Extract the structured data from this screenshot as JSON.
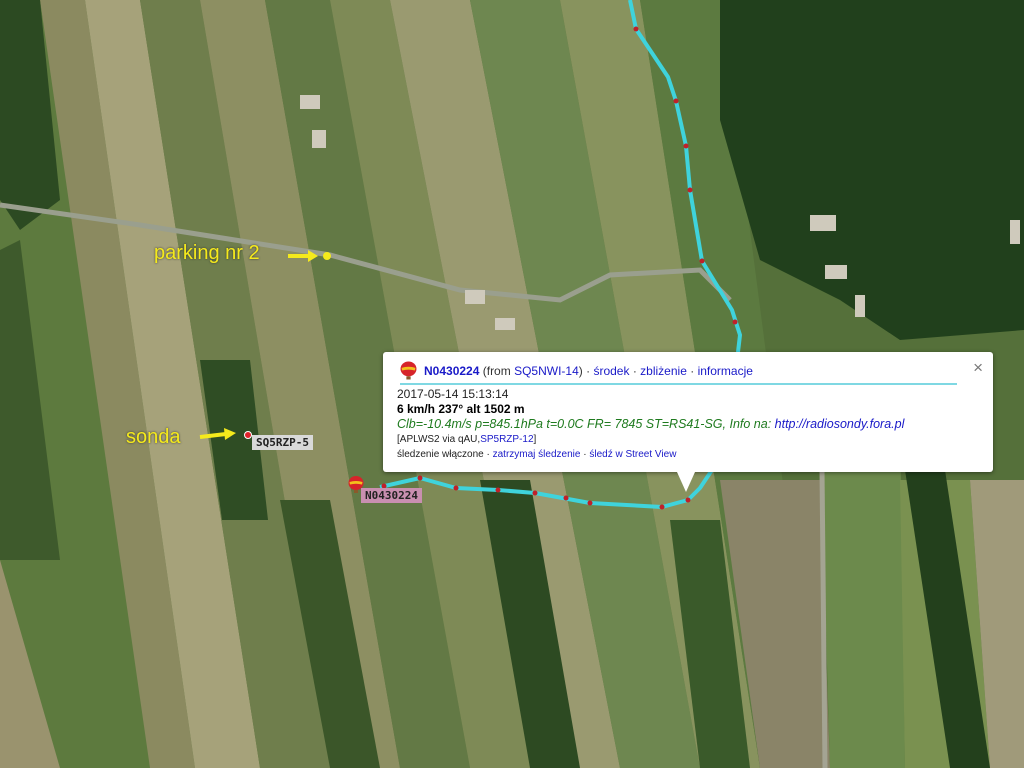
{
  "annotations": {
    "parking_label": "parking nr 2",
    "sonda_label": "sonda"
  },
  "stations": {
    "ground_station": {
      "label": "SQ5RZP-5",
      "bg": "#d9d9d9",
      "color": "#222222"
    },
    "balloon": {
      "label": "N0430224",
      "bg": "#c98fb0",
      "color": "#222222"
    }
  },
  "colors": {
    "track": "#3fd3dc",
    "track_point": "#c0202a",
    "annotation": "#f5ea1c",
    "link": "#1a1ac8",
    "comment": "#1e7a1e"
  },
  "popup": {
    "icon": "balloon-icon",
    "name": "N0430224",
    "from_prefix": "(from ",
    "from_station": "SQ5NWI-14",
    "from_suffix": ")",
    "links": [
      "środek",
      "zbliżenie",
      "informacje"
    ],
    "close_label": "×",
    "timestamp": "2017-05-14 15:13:14",
    "speed_line": "6 km/h 237° alt 1502 m",
    "comment_text": "Clb=-10.4m/s p=845.1hPa t=0.0C FR= 7845 ST=RS41-SG, Info na: ",
    "comment_link": "http://radiosondy.fora.pl",
    "path_prefix": "[APLWS2 via qAU,",
    "path_station": "SP5RZP-12",
    "path_suffix": "]",
    "tracking_label": "śledzenie włączone",
    "tracking_links": [
      "zatrzymaj śledzenie",
      "śledź w Street View"
    ]
  }
}
